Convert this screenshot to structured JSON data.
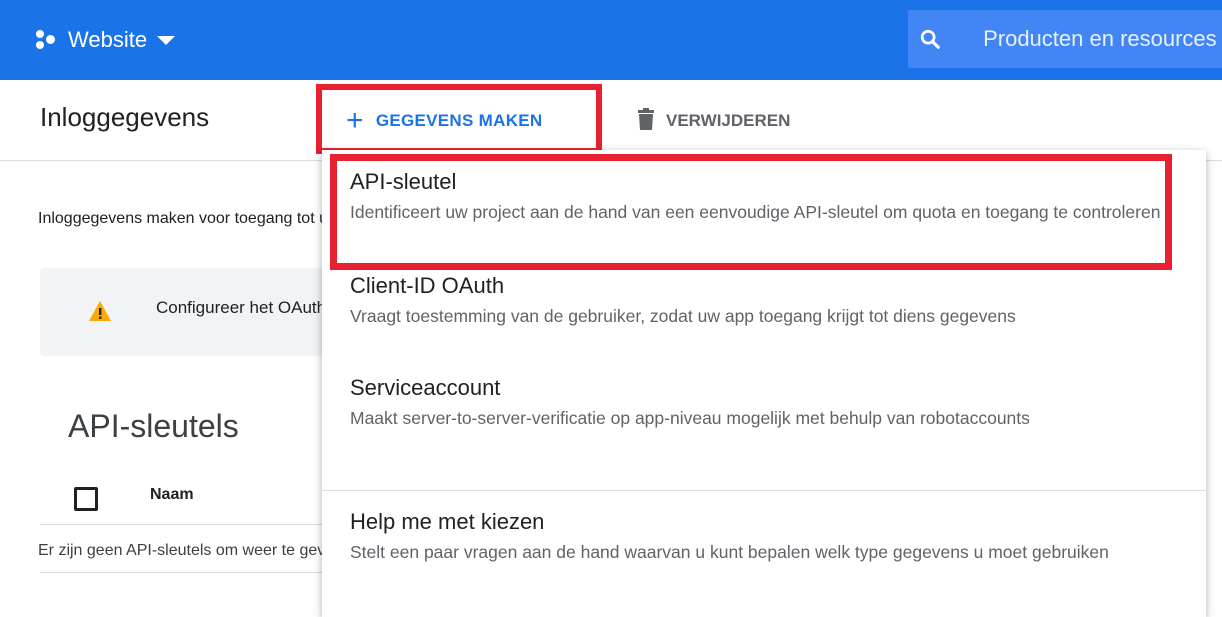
{
  "topbar": {
    "project_name": "Website",
    "search_placeholder": "Producten en resources zoeken"
  },
  "header": {
    "title": "Inloggegevens",
    "create_label": "GEGEVENS MAKEN",
    "delete_label": "VERWIJDEREN"
  },
  "content": {
    "intro": "Inloggegevens maken voor toegang tot uw ingeschakelde API's",
    "warning": "Configureer het OAuth-toestemmingsscherm",
    "section_title": "API-sleutels",
    "column_name": "Naam",
    "empty": "Er zijn geen API-sleutels om weer te geven"
  },
  "menu": {
    "items": [
      {
        "title": "API-sleutel",
        "desc": "Identificeert uw project aan de hand van een eenvoudige API-sleutel om quota en toegang te controleren"
      },
      {
        "title": "Client-ID OAuth",
        "desc": "Vraagt toestemming van de gebruiker, zodat uw app toegang krijgt tot diens gegevens"
      },
      {
        "title": "Serviceaccount",
        "desc": "Maakt server-to-server-verificatie op app-niveau mogelijk met behulp van robotaccounts"
      },
      {
        "title": "Help me met kiezen",
        "desc": "Stelt een paar vragen aan de hand waarvan u kunt bepalen welk type gegevens u moet gebruiken"
      }
    ]
  },
  "colors": {
    "brand": "#1a73e8",
    "highlight": "#e8202f",
    "warning": "#f9ab00"
  }
}
